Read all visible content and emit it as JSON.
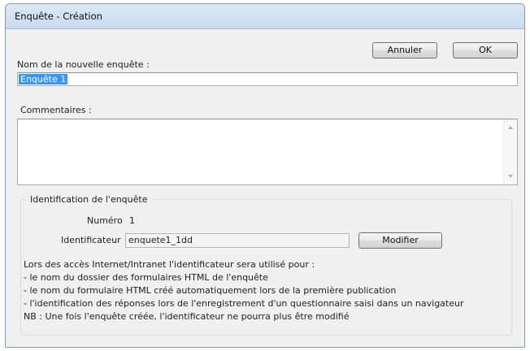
{
  "window": {
    "title": "Enquête - Création"
  },
  "buttons": {
    "cancel": "Annuler",
    "ok": "OK",
    "modify": "Modifier"
  },
  "form": {
    "name_label": "Nom de la nouvelle enquête :",
    "name_value": "Enquête 1",
    "comments_label": "Commentaires :",
    "comments_value": ""
  },
  "identification": {
    "group_label": "Identification de l'enquête",
    "number_label": "Numéro",
    "number_value": "1",
    "identifier_label": "Identificateur",
    "identifier_value": "enquete1_1dd"
  },
  "info_lines": [
    "Lors des accès Internet/Intranet l'identificateur sera utilisé pour :",
    "- le nom du dossier des formulaires HTML de l'enquête",
    "- le nom du formulaire HTML créé automatiquement lors de la première publication",
    "- l'identification des réponses lors de l'enregistrement d'un questionnaire saisi dans un navigateur",
    "NB : Une fois l'enquête créée, l'identificateur ne pourra plus être modifié"
  ]
}
